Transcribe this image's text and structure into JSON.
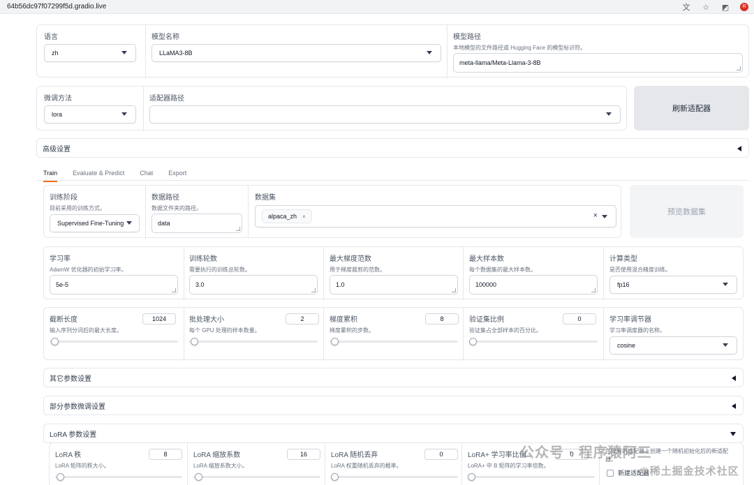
{
  "browser": {
    "url": "64b56dc97f07299f5d.gradio.live"
  },
  "top": {
    "lang": {
      "label": "语言",
      "value": "zh"
    },
    "model_name": {
      "label": "模型名称",
      "value": "LLaMA3-8B"
    },
    "model_path": {
      "label": "模型路径",
      "info": "本地模型的文件路径或 Hugging Face 的模型标识符。",
      "value": "meta-llama/Meta-Llama-3-8B"
    }
  },
  "finetune": {
    "method": {
      "label": "微调方法",
      "value": "lora"
    },
    "adapter": {
      "label": "适配器路径",
      "value": ""
    },
    "refresh_button": "刷新适配器"
  },
  "advanced": {
    "label": "高级设置"
  },
  "tabs": [
    "Train",
    "Evaluate & Predict",
    "Chat",
    "Export"
  ],
  "train": {
    "stage": {
      "label": "训练阶段",
      "info": "目前采用的训练方式。",
      "value": "Supervised Fine-Tuning"
    },
    "data_dir": {
      "label": "数据路径",
      "info": "数据文件夹的路径。",
      "value": "data"
    },
    "dataset": {
      "label": "数据集",
      "tags": [
        "alpaca_zh"
      ]
    },
    "preview_button": "预览数据集",
    "row2": [
      {
        "label": "学习率",
        "info": "AdamW 优化器的初始学习率。",
        "value": "5e-5"
      },
      {
        "label": "训练轮数",
        "info": "需要执行的训练总轮数。",
        "value": "3.0"
      },
      {
        "label": "最大梯度范数",
        "info": "用于梯度裁剪的范数。",
        "value": "1.0"
      },
      {
        "label": "最大样本数",
        "info": "每个数据集的最大样本数。",
        "value": "100000"
      }
    ],
    "compute_type": {
      "label": "计算类型",
      "info": "是否使用混合精度训练。",
      "value": "fp16"
    },
    "row3": [
      {
        "label": "截断长度",
        "info": "输入序列分词后的最大长度。",
        "value": "1024",
        "level": 0.01
      },
      {
        "label": "批处理大小",
        "info": "每个 GPU 处理的样本数量。",
        "value": "2",
        "level": 0.01
      },
      {
        "label": "梯度累积",
        "info": "梯度累积的步数。",
        "value": "8",
        "level": 0.01
      },
      {
        "label": "验证集比例",
        "info": "验证集占全部样本的百分比。",
        "value": "0",
        "level": 0.0
      }
    ],
    "scheduler": {
      "label": "学习率调节器",
      "info": "学习率调度器的名称。",
      "value": "cosine"
    },
    "accordions": {
      "other": "其它参数设置",
      "freeze": "部分参数微调设置",
      "lora": "LoRA 参数设置"
    },
    "lora": [
      {
        "label": "LoRA 秩",
        "info": "LoRA 矩阵的秩大小。",
        "value": "8",
        "level": 0.01
      },
      {
        "label": "LoRA 缩放系数",
        "info": "LoRA 缩放系数大小。",
        "value": "16",
        "level": 0.01
      },
      {
        "label": "LoRA 随机丢弃",
        "info": "LoRA 权重随机丢弃的概率。",
        "value": "0",
        "level": 0.0
      },
      {
        "label": "LoRA+ 学习率比例",
        "info": "LoRA+ 中 B 矩阵的学习率倍数。",
        "value": "0",
        "level": 0.0
      }
    ],
    "new_adapter": {
      "info": "在现有的适配器上创建一个随机初始化后的新适配器。",
      "label": "新建适配器"
    }
  },
  "watermark": {
    "line1": "公众号 · 程序猿阿三",
    "line2": "@稀土掘金技术社区"
  }
}
